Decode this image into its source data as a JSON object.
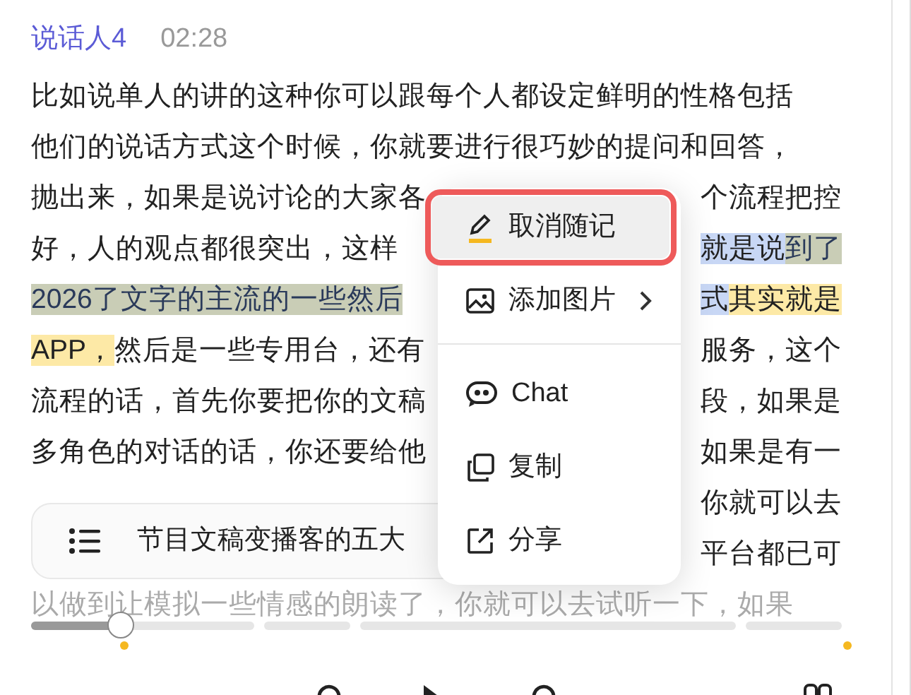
{
  "speaker": {
    "name": "说话人4",
    "time": "02:28"
  },
  "lines": [
    {
      "left": [
        {
          "text": "比如说单人的讲的这种你可以跟每个人都设定鲜明的性格包括",
          "selected": false,
          "noted": false
        }
      ]
    },
    {
      "left": [
        {
          "text": "他们的说话方式这个时候，你就要进行很巧妙的提问和回答，",
          "selected": false,
          "noted": false
        }
      ]
    },
    {
      "left": [
        {
          "text": "抛出来，如果是说讨论的大家各",
          "selected": false,
          "noted": false
        }
      ],
      "right": [
        {
          "text": "个流程把控",
          "selected": false,
          "noted": false
        }
      ]
    },
    {
      "left": [
        {
          "text": "好，人的观点都很突出，这样",
          "selected": false,
          "noted": false
        }
      ],
      "right": [
        {
          "text": "就是说",
          "selected": true,
          "noted": false
        },
        {
          "text": "到了",
          "selected": true,
          "noted": true
        }
      ]
    },
    {
      "left": [
        {
          "text": "2026了文字的主流的一些然后",
          "selected": true,
          "noted": true
        }
      ],
      "right": [
        {
          "text": "式",
          "selected": true,
          "noted": false
        },
        {
          "text": "其实就是",
          "selected": false,
          "noted": true
        }
      ]
    },
    {
      "left": [
        {
          "text": "APP，",
          "selected": false,
          "noted": true
        },
        {
          "text": "然后是一些专用台，还有",
          "selected": false,
          "noted": false
        }
      ],
      "right": [
        {
          "text": "服务，这个",
          "selected": false,
          "noted": false
        }
      ]
    },
    {
      "left": [
        {
          "text": "流程的话，首先你要把你的文稿",
          "selected": false,
          "noted": false
        }
      ],
      "right": [
        {
          "text": "段，如果是",
          "selected": false,
          "noted": false
        }
      ]
    },
    {
      "left": [
        {
          "text": "多角色的对话的话，你还要给他",
          "selected": false,
          "noted": false
        }
      ],
      "right": [
        {
          "text": "如果是有一",
          "selected": false,
          "noted": false
        }
      ]
    },
    {
      "right": [
        {
          "text": "你就可以去",
          "selected": false,
          "noted": false
        }
      ]
    },
    {
      "right": [
        {
          "text": "平台都已可",
          "selected": false,
          "noted": false
        }
      ]
    },
    {
      "left": [
        {
          "text": "以做到让模拟一些情感的朗读了，你就可以去试听一下，如果",
          "selected": false,
          "noted": false
        }
      ],
      "faded": true
    }
  ],
  "outline_bar": {
    "title": "节目文稿变播客的五大"
  },
  "context_menu": {
    "items": [
      {
        "kind": "unnote",
        "label": "取消随记",
        "selected": true
      },
      {
        "kind": "image",
        "label": "添加图片",
        "submenu": true
      },
      {
        "kind": "divider"
      },
      {
        "kind": "chat",
        "label": "Chat"
      },
      {
        "kind": "copy",
        "label": "复制"
      },
      {
        "kind": "share",
        "label": "分享"
      }
    ]
  },
  "player": {
    "level": 0.11
  }
}
